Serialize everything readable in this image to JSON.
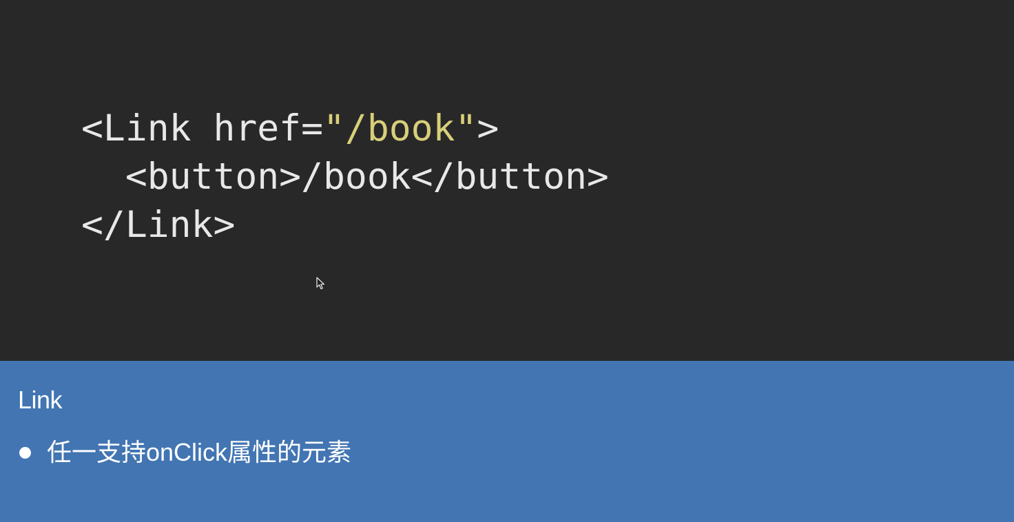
{
  "code": {
    "line1": {
      "open": "<Link href=",
      "string": "\"/book\"",
      "close": ">"
    },
    "line2": "  <button>/book</button>",
    "line3": "</Link>",
    "colors": {
      "background": "#282828",
      "text": "#e8e8e8",
      "string": "#d8cf7a"
    }
  },
  "notes": {
    "title": "Link",
    "items": [
      {
        "text": "任一支持onClick属性的元素"
      }
    ],
    "colors": {
      "background": "#4275b2",
      "text": "#ffffff"
    }
  },
  "pointer": {
    "icon": "mouse-pointer-icon"
  }
}
